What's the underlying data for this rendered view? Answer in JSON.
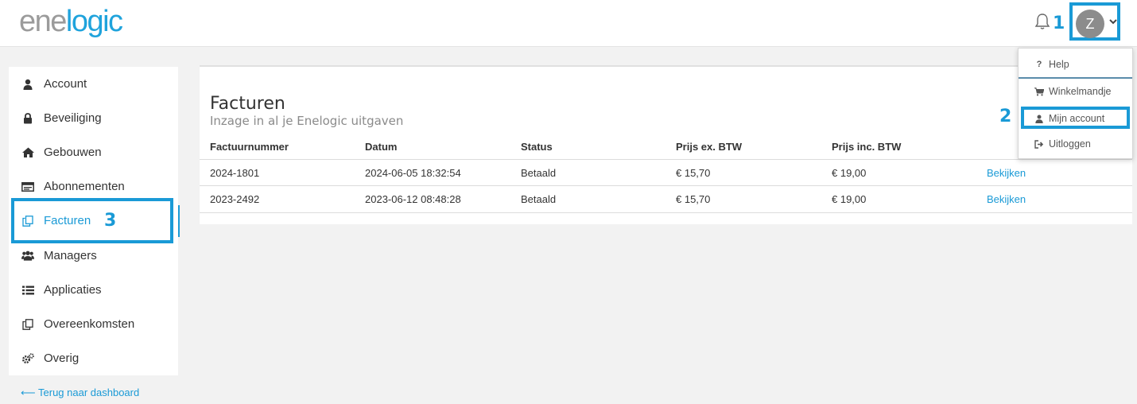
{
  "header": {
    "logo": {
      "part1": "ene",
      "part2": "logic"
    },
    "annotations": {
      "user_menu": "1",
      "my_account": "2",
      "invoices": "3"
    },
    "user": {
      "initial": "Z"
    }
  },
  "sidebar": {
    "items": [
      {
        "label": "Account",
        "icon": "user-icon"
      },
      {
        "label": "Beveiliging",
        "icon": "lock-icon"
      },
      {
        "label": "Gebouwen",
        "icon": "home-icon"
      },
      {
        "label": "Abonnementen",
        "icon": "card-icon"
      },
      {
        "label": "Facturen",
        "icon": "copy-icon",
        "active": true
      },
      {
        "label": "Managers",
        "icon": "users-icon"
      },
      {
        "label": "Applicaties",
        "icon": "list-icon"
      },
      {
        "label": "Overeenkomsten",
        "icon": "copy-icon"
      },
      {
        "label": "Overig",
        "icon": "cogs-icon"
      }
    ],
    "back_link": "⟵ Terug naar dashboard"
  },
  "main": {
    "title": "Facturen",
    "subtitle": "Inzage in al je Enelogic uitgaven",
    "columns": [
      "Factuurnummer",
      "Datum",
      "Status",
      "Prijs ex. BTW",
      "Prijs inc. BTW"
    ],
    "rows": [
      {
        "number": "2024-1801",
        "date": "2024-06-05 18:32:54",
        "status": "Betaald",
        "price_ex": "€ 15,70",
        "price_inc": "€ 19,00",
        "action": "Bekijken"
      },
      {
        "number": "2023-2492",
        "date": "2023-06-12 08:48:28",
        "status": "Betaald",
        "price_ex": "€ 15,70",
        "price_inc": "€ 19,00",
        "action": "Bekijken"
      }
    ]
  },
  "dropdown": {
    "items": [
      {
        "label": "Help",
        "icon": "question-icon"
      },
      {
        "label": "Winkelmandje",
        "icon": "cart-icon"
      },
      {
        "label": "Mijn account",
        "icon": "user-icon"
      },
      {
        "label": "Uitloggen",
        "icon": "logout-icon"
      }
    ]
  },
  "colors": {
    "accent": "#1a9ad6",
    "logo_grey": "#9b9b9b",
    "logo_blue": "#1fa3dc"
  }
}
